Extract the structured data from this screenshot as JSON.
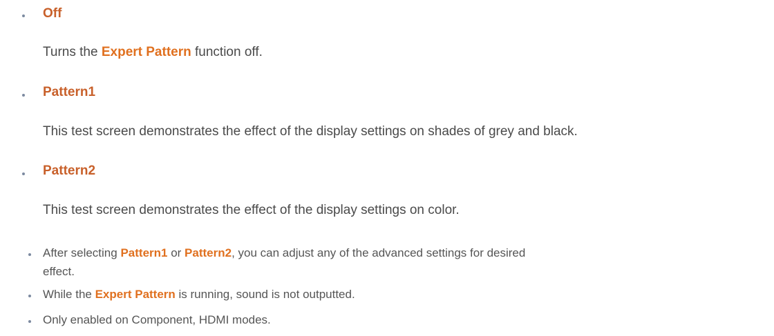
{
  "items": [
    {
      "heading": "Off",
      "desc": {
        "pre": "Turns the ",
        "hl": "Expert Pattern",
        "post": " function off."
      }
    },
    {
      "heading": "Pattern1",
      "desc": {
        "text": "This test screen demonstrates the effect of the display settings on shades of grey and black."
      }
    },
    {
      "heading": "Pattern2",
      "desc": {
        "text": "This test screen demonstrates the effect of the display settings on color."
      }
    }
  ],
  "notes": [
    {
      "pre": "After selecting ",
      "hl1": "Pattern1",
      "mid": " or ",
      "hl2": "Pattern2",
      "post": ", you can adjust any of the advanced settings for desired",
      "line2": "effect."
    },
    {
      "pre": "While the ",
      "hl": "Expert Pattern",
      "post": " is running, sound is not outputted."
    },
    {
      "text": "Only enabled on Component, HDMI modes."
    }
  ],
  "colors": {
    "heading": "#c8602a",
    "highlight": "#e0701f",
    "body_text": "#4a4a4a",
    "bullet": "#7c8aa0"
  }
}
